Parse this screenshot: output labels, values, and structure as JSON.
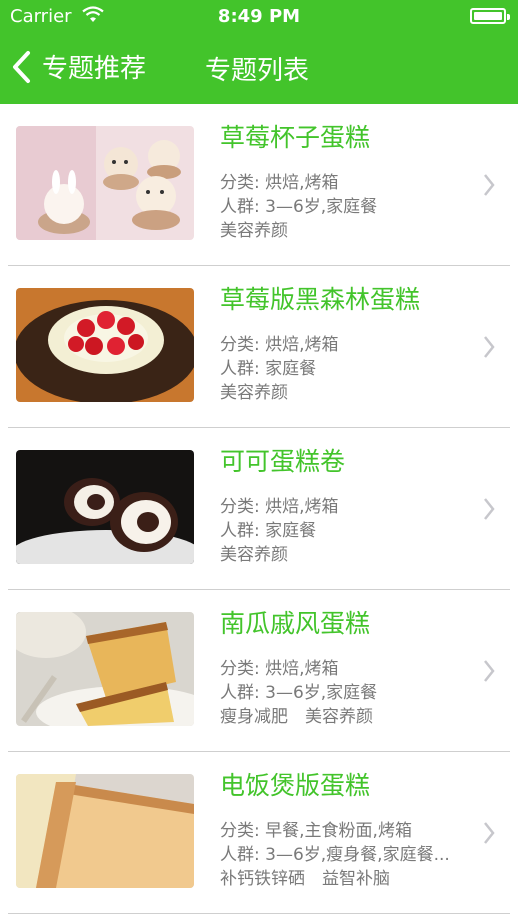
{
  "status": {
    "carrier": "Carrier",
    "time": "8:49 PM"
  },
  "nav": {
    "back_label": "专题推荐",
    "title": "专题列表"
  },
  "colors": {
    "accent": "#43c42b",
    "text_secondary": "#7a7a7a"
  },
  "items": [
    {
      "name": "草莓杯子蛋糕",
      "category": "分类: 烘焙,烤箱",
      "audience": "人群: 3—6岁,家庭餐",
      "tags": "美容养颜",
      "icon": "cupcake-photo"
    },
    {
      "name": "草莓版黑森林蛋糕",
      "category": "分类: 烘焙,烤箱",
      "audience": "人群: 家庭餐",
      "tags": "美容养颜",
      "icon": "black-forest-cake-photo"
    },
    {
      "name": "可可蛋糕卷",
      "category": "分类: 烘焙,烤箱",
      "audience": "人群: 家庭餐",
      "tags": "美容养颜",
      "icon": "cocoa-roll-photo"
    },
    {
      "name": "南瓜戚风蛋糕",
      "category": "分类: 烘焙,烤箱",
      "audience": "人群: 3—6岁,家庭餐",
      "tags": "瘦身减肥　美容养颜",
      "icon": "chiffon-cake-photo"
    },
    {
      "name": "电饭煲版蛋糕",
      "category": "分类: 早餐,主食粉面,烤箱",
      "audience": "人群: 3—6岁,瘦身餐,家庭餐...",
      "tags": "补钙铁锌硒　益智补脑",
      "icon": "rice-cooker-cake-photo"
    }
  ]
}
